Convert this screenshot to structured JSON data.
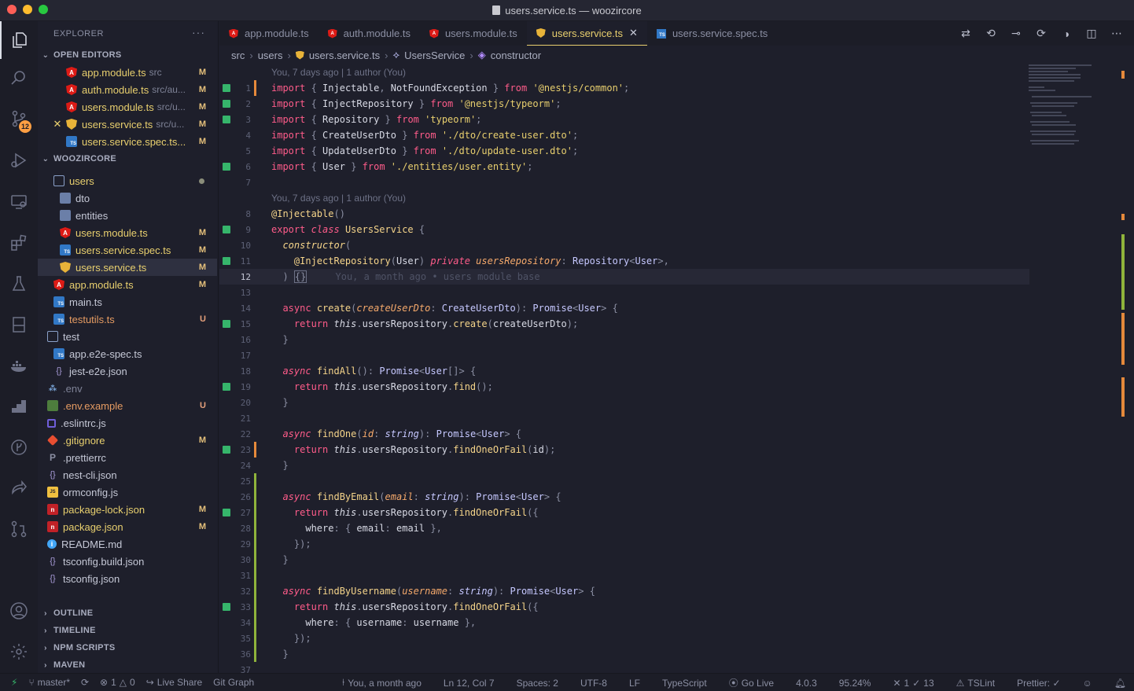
{
  "window": {
    "title": "users.service.ts — woozircore"
  },
  "activity_bar": {
    "scm_badge": "12"
  },
  "explorer": {
    "title": "EXPLORER",
    "more": "···",
    "open_editors_label": "OPEN EDITORS",
    "open_editors": [
      {
        "name": "app.module.ts",
        "path": "src",
        "status": "M",
        "icon": "angular-icon"
      },
      {
        "name": "auth.module.ts",
        "path": "src/au...",
        "status": "M",
        "icon": "angular-icon"
      },
      {
        "name": "users.module.ts",
        "path": "src/u...",
        "status": "M",
        "icon": "angular-icon"
      },
      {
        "name": "users.service.ts",
        "path": "src/u...",
        "status": "M",
        "icon": "shield-icon"
      },
      {
        "name": "users.service.spec.ts...",
        "path": "",
        "status": "M",
        "icon": "typescript-icon"
      }
    ],
    "workspace_label": "WOOZIRCORE",
    "tree": [
      {
        "name": "users",
        "status": "",
        "icon": "folder-open-icon"
      },
      {
        "name": "dto",
        "status": "",
        "icon": "folder-icon"
      },
      {
        "name": "entities",
        "status": "",
        "icon": "folder-icon"
      },
      {
        "name": "users.module.ts",
        "status": "M",
        "icon": "angular-icon"
      },
      {
        "name": "users.service.spec.ts",
        "status": "M",
        "icon": "typescript-icon"
      },
      {
        "name": "users.service.ts",
        "status": "M",
        "icon": "shield-icon"
      },
      {
        "name": "app.module.ts",
        "status": "M",
        "icon": "angular-icon"
      },
      {
        "name": "main.ts",
        "status": "",
        "icon": "typescript-icon"
      },
      {
        "name": "testutils.ts",
        "status": "U",
        "icon": "typescript-icon"
      },
      {
        "name": "test",
        "status": "",
        "icon": "folder-open-icon"
      },
      {
        "name": "app.e2e-spec.ts",
        "status": "",
        "icon": "typescript-icon"
      },
      {
        "name": "jest-e2e.json",
        "status": "",
        "icon": "json-icon"
      },
      {
        "name": ".env",
        "status": "",
        "icon": "env-icon"
      },
      {
        "name": ".env.example",
        "status": "U",
        "icon": "env-example-icon"
      },
      {
        "name": ".eslintrc.js",
        "status": "",
        "icon": "eslint-icon"
      },
      {
        "name": ".gitignore",
        "status": "M",
        "icon": "git-icon"
      },
      {
        "name": ".prettierrc",
        "status": "",
        "icon": "prettier-icon"
      },
      {
        "name": "nest-cli.json",
        "status": "",
        "icon": "json-icon"
      },
      {
        "name": "ormconfig.js",
        "status": "",
        "icon": "javascript-icon"
      },
      {
        "name": "package-lock.json",
        "status": "M",
        "icon": "npm-icon"
      },
      {
        "name": "package.json",
        "status": "M",
        "icon": "npm-icon"
      },
      {
        "name": "README.md",
        "status": "",
        "icon": "info-icon"
      },
      {
        "name": "tsconfig.build.json",
        "status": "",
        "icon": "json-icon"
      },
      {
        "name": "tsconfig.json",
        "status": "",
        "icon": "json-icon"
      }
    ],
    "collapsed_sections": [
      "OUTLINE",
      "TIMELINE",
      "NPM SCRIPTS",
      "MAVEN"
    ]
  },
  "tabs": [
    {
      "label": "app.module.ts",
      "icon": "angular-icon",
      "active": false
    },
    {
      "label": "auth.module.ts",
      "icon": "angular-icon",
      "active": false
    },
    {
      "label": "users.module.ts",
      "icon": "angular-icon",
      "active": false
    },
    {
      "label": "users.service.ts",
      "icon": "shield-icon",
      "active": true
    },
    {
      "label": "users.service.spec.ts",
      "icon": "typescript-icon",
      "active": false
    }
  ],
  "breadcrumb": [
    "src",
    "users",
    "users.service.ts",
    "UsersService",
    "constructor"
  ],
  "codelens": {
    "top": "You, 7 days ago | 1 author (You)",
    "class": "You, 7 days ago | 1 author (You)",
    "inline_blame": "You, a month ago • users module base"
  },
  "code_lines": [
    {
      "n": "1",
      "text": "import { Injectable, NotFoundException } from '@nestjs/common';"
    },
    {
      "n": "2",
      "text": "import { InjectRepository } from '@nestjs/typeorm';"
    },
    {
      "n": "3",
      "text": "import { Repository } from 'typeorm';"
    },
    {
      "n": "4",
      "text": "import { CreateUserDto } from './dto/create-user.dto';"
    },
    {
      "n": "5",
      "text": "import { UpdateUserDto } from './dto/update-user.dto';"
    },
    {
      "n": "6",
      "text": "import { User } from './entities/user.entity';"
    },
    {
      "n": "7",
      "text": ""
    },
    {
      "n": "8",
      "text": "@Injectable()"
    },
    {
      "n": "9",
      "text": "export class UsersService {"
    },
    {
      "n": "10",
      "text": "  constructor("
    },
    {
      "n": "11",
      "text": "    @InjectRepository(User) private usersRepository: Repository<User>,"
    },
    {
      "n": "12",
      "text": "  ) {}"
    },
    {
      "n": "13",
      "text": ""
    },
    {
      "n": "14",
      "text": "  async create(createUserDto: CreateUserDto): Promise<User> {"
    },
    {
      "n": "15",
      "text": "    return this.usersRepository.create(createUserDto);"
    },
    {
      "n": "16",
      "text": "  }"
    },
    {
      "n": "17",
      "text": ""
    },
    {
      "n": "18",
      "text": "  async findAll(): Promise<User[]> {"
    },
    {
      "n": "19",
      "text": "    return this.usersRepository.find();"
    },
    {
      "n": "20",
      "text": "  }"
    },
    {
      "n": "21",
      "text": ""
    },
    {
      "n": "22",
      "text": "  async findOne(id: string): Promise<User> {"
    },
    {
      "n": "23",
      "text": "    return this.usersRepository.findOneOrFail(id);"
    },
    {
      "n": "24",
      "text": "  }"
    },
    {
      "n": "25",
      "text": ""
    },
    {
      "n": "26",
      "text": "  async findByEmail(email: string): Promise<User> {"
    },
    {
      "n": "27",
      "text": "    return this.usersRepository.findOneOrFail({"
    },
    {
      "n": "28",
      "text": "      where: { email: email },"
    },
    {
      "n": "29",
      "text": "    });"
    },
    {
      "n": "30",
      "text": "  }"
    },
    {
      "n": "31",
      "text": ""
    },
    {
      "n": "32",
      "text": "  async findByUsername(username: string): Promise<User> {"
    },
    {
      "n": "33",
      "text": "    return this.usersRepository.findOneOrFail({"
    },
    {
      "n": "34",
      "text": "      where: { username: username },"
    },
    {
      "n": "35",
      "text": "    });"
    },
    {
      "n": "36",
      "text": "  }"
    },
    {
      "n": "37",
      "text": ""
    }
  ],
  "statusbar": {
    "branch": "master*",
    "problems_errors": "1",
    "problems_warnings": "0",
    "live_share": "Live Share",
    "git_graph": "Git Graph",
    "blame": "You, a month ago",
    "cursor": "Ln 12, Col 7",
    "spaces": "Spaces: 2",
    "encoding": "UTF-8",
    "eol": "LF",
    "language": "TypeScript",
    "go_live": "Go Live",
    "ts_version": "4.0.3",
    "coverage": "95.24%",
    "tests_failed": "1",
    "tests_passed": "13",
    "tslint": "TSLint",
    "prettier": "Prettier: ✓"
  },
  "colors": {
    "accent": "#e8cf6e",
    "modified": "#e5c07b",
    "git_added": "#36b56b",
    "badge": "#ff9f43"
  }
}
